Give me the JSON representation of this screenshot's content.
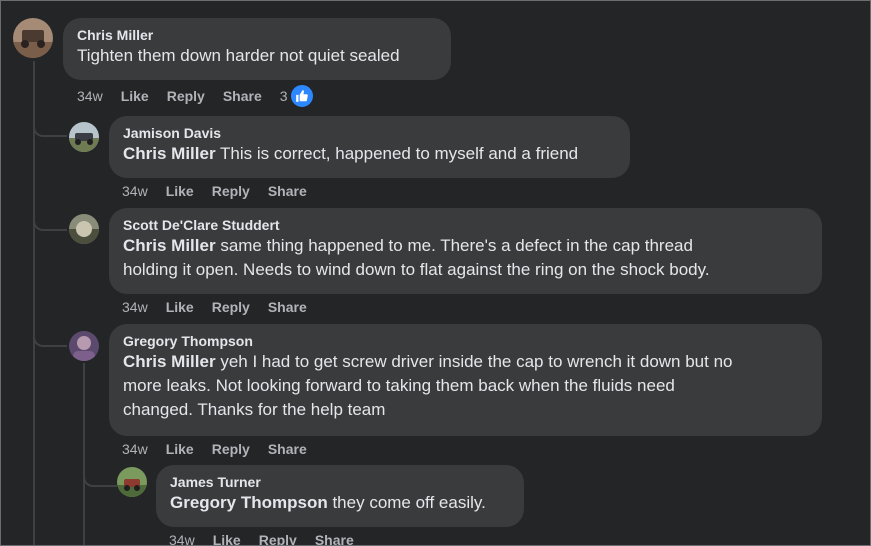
{
  "comments": [
    {
      "author": "Chris Miller",
      "text": "Tighten them down harder not quiet sealed",
      "time": "34w",
      "like": "Like",
      "reply": "Reply",
      "share": "Share",
      "reaction_count": "3"
    },
    {
      "author": "Jamison Davis",
      "mention": "Chris Miller",
      "text": " This is correct, happened to myself and a friend",
      "time": "34w",
      "like": "Like",
      "reply": "Reply",
      "share": "Share"
    },
    {
      "author": "Scott De'Clare Studdert",
      "mention": "Chris Miller",
      "text_line1": " same thing happened to me. There's a defect in the cap thread",
      "text_line2": "holding it open. Needs to wind down to flat against the ring on the shock body.",
      "time": "34w",
      "like": "Like",
      "reply": "Reply",
      "share": "Share"
    },
    {
      "author": "Gregory Thompson",
      "mention": "Chris Miller",
      "text_line1": " yeh I had to get screw driver inside the cap to wrench it down but no",
      "text_line2": "more leaks. Not looking forward to taking them back when the fluids need",
      "text_line3": "changed. Thanks for the help team",
      "time": "34w",
      "like": "Like",
      "reply": "Reply",
      "share": "Share"
    },
    {
      "author": "James Turner",
      "mention": "Gregory Thompson",
      "text": " they come off easily.",
      "time": "34w",
      "like": "Like",
      "reply": "Reply",
      "share": "Share"
    }
  ],
  "colors": {
    "background": "#242526",
    "bubble": "#3a3b3c",
    "primary_text": "#e4e6eb",
    "secondary_text": "#b0b3b8",
    "like_badge": "#2d88ff"
  }
}
